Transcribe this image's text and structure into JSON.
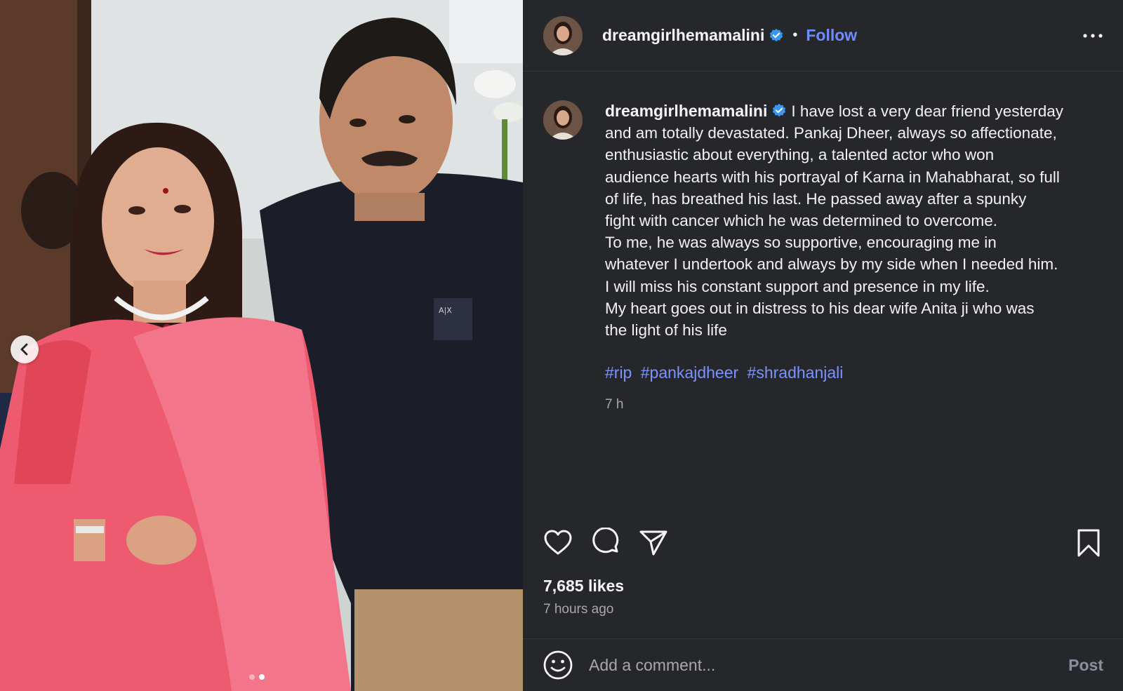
{
  "post": {
    "username": "dreamgirlhemamalini",
    "separator": "•",
    "follow_label": "Follow",
    "caption_lines": [
      "I have lost a very dear friend yesterday",
      "and am totally devastated. Pankaj Dheer, always so affectionate,",
      "enthusiastic about everything, a talented actor who won",
      "audience hearts with his portrayal of Karna in Mahabharat, so full",
      "of life, has breathed his last. He passed away after a spunky",
      "fight with cancer which he was determined to overcome.",
      "To me, he was always so supportive, encouraging me in",
      "whatever I undertook and always by my side when I needed him.",
      "I will miss his constant support and presence in my life.",
      "My heart goes out in distress to his dear wife Anita ji who was",
      "the light of his life"
    ],
    "hashtags": [
      "#rip",
      "#pankajdheer",
      "#shradhanjali"
    ],
    "caption_time": "7 h",
    "likes": "7,685 likes",
    "time_ago": "7 hours ago"
  },
  "comment": {
    "placeholder": "Add a comment...",
    "post_label": "Post"
  },
  "media": {
    "carousel_total": 2,
    "carousel_active": 2
  },
  "icons": {
    "verified": "verified-badge-icon",
    "more": "more-options-icon",
    "like": "heart-icon",
    "comment": "comment-icon",
    "share": "share-icon",
    "save": "bookmark-icon",
    "emoji": "emoji-icon",
    "prev": "chevron-left-icon"
  },
  "colors": {
    "background": "#25272b",
    "accent": "#6f8cff",
    "hashtag": "#7b92ff",
    "muted": "#a8a8a8",
    "verified": "#3897f0"
  }
}
